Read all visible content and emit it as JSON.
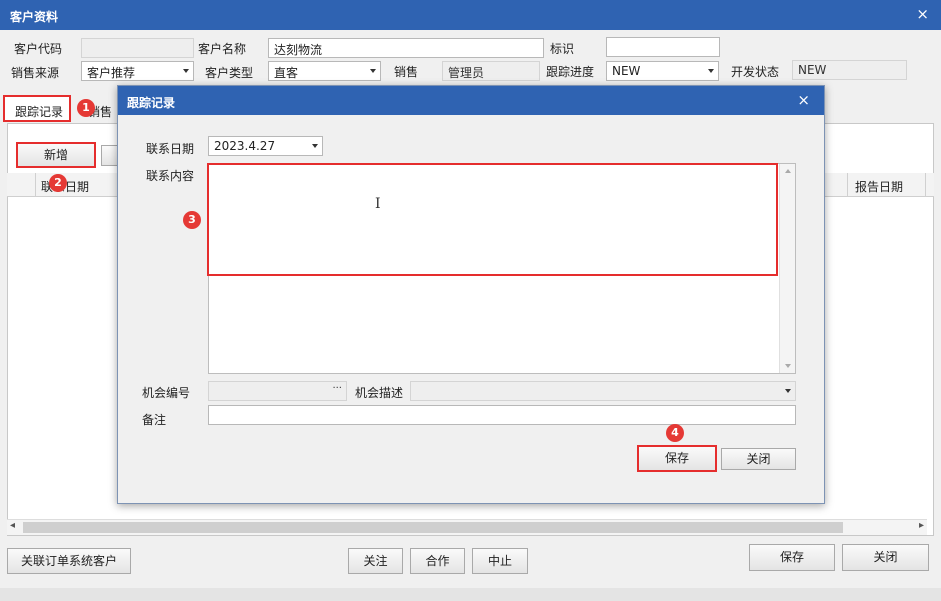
{
  "window": {
    "title": "客户资料",
    "close": "×"
  },
  "form": {
    "code_label": "客户代码",
    "code_value": "",
    "name_label": "客户名称",
    "name_value": "达刻物流",
    "mark_label": "标识",
    "mark_value": "",
    "source_label": "销售来源",
    "source_value": "客户推荐",
    "type_label": "客户类型",
    "type_value": "直客",
    "sales_label": "销售",
    "sales_value": "管理员",
    "progress_label": "跟踪进度",
    "progress_value": "NEW",
    "dev_status_label": "开发状态",
    "dev_status_value": "NEW"
  },
  "tabs": [
    {
      "label": "跟踪记录"
    },
    {
      "label": "销售机"
    }
  ],
  "toolbar": {
    "add_label": "新增"
  },
  "grid": {
    "col_date": "联系日期",
    "col_report": "报告日期"
  },
  "badges": [
    "1",
    "2",
    "3",
    "4"
  ],
  "dialog": {
    "title": "跟踪记录",
    "close": "×",
    "date_label": "联系日期",
    "date_value": "2023.4.27",
    "content_label": "联系内容",
    "content_value": "",
    "opp_no_label": "机会编号",
    "opp_no_value": "",
    "opp_desc_label": "机会描述",
    "opp_desc_value": "",
    "remark_label": "备注",
    "remark_value": "",
    "save_label": "保存",
    "close_label": "关闭"
  },
  "footer": {
    "link_label": "关联订单系统客户",
    "follow_label": "关注",
    "coop_label": "合作",
    "stop_label": "中止",
    "save_label": "保存",
    "close_label": "关闭"
  },
  "scroll": {
    "left": "◂",
    "right": "▸"
  },
  "icons": {
    "ellipsis": "···",
    "text_cursor": "I"
  },
  "colors": {
    "title_bar": "#2f63b2",
    "highlight": "#e52d2d",
    "badge": "#e53935"
  }
}
